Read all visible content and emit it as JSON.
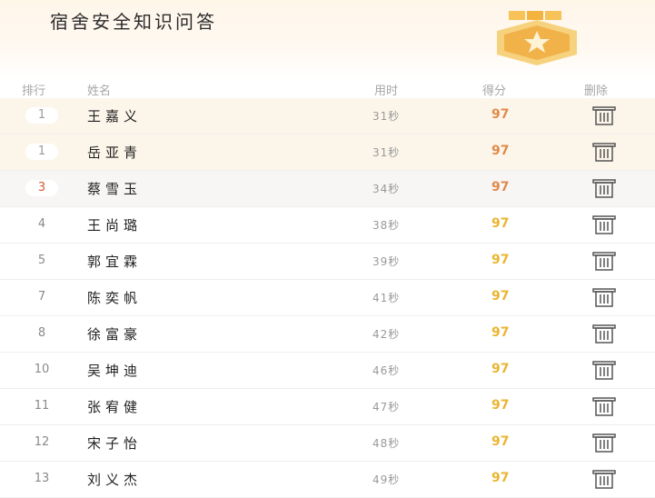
{
  "header": {
    "title": "宿舍安全知识问答"
  },
  "columns": {
    "rank": "排行",
    "name": "姓名",
    "time": "用时",
    "score": "得分",
    "delete": "删除"
  },
  "icons": {
    "medal": "medal-star-icon",
    "delete": "trash-icon"
  },
  "rows": [
    {
      "rank": "1",
      "name": "王嘉义",
      "time": "31秒",
      "score": "97"
    },
    {
      "rank": "1",
      "name": "岳亚青",
      "time": "31秒",
      "score": "97"
    },
    {
      "rank": "3",
      "name": "蔡雪玉",
      "time": "34秒",
      "score": "97"
    },
    {
      "rank": "4",
      "name": "王尚璐",
      "time": "38秒",
      "score": "97"
    },
    {
      "rank": "5",
      "name": "郭宜霖",
      "time": "39秒",
      "score": "97"
    },
    {
      "rank": "7",
      "name": "陈奕帆",
      "time": "41秒",
      "score": "97"
    },
    {
      "rank": "8",
      "name": "徐富豪",
      "time": "42秒",
      "score": "97"
    },
    {
      "rank": "10",
      "name": "吴坤迪",
      "time": "46秒",
      "score": "97"
    },
    {
      "rank": "11",
      "name": "张宥健",
      "time": "47秒",
      "score": "97"
    },
    {
      "rank": "12",
      "name": "宋子怡",
      "time": "48秒",
      "score": "97"
    },
    {
      "rank": "13",
      "name": "刘义杰",
      "time": "49秒",
      "score": "97"
    }
  ]
}
